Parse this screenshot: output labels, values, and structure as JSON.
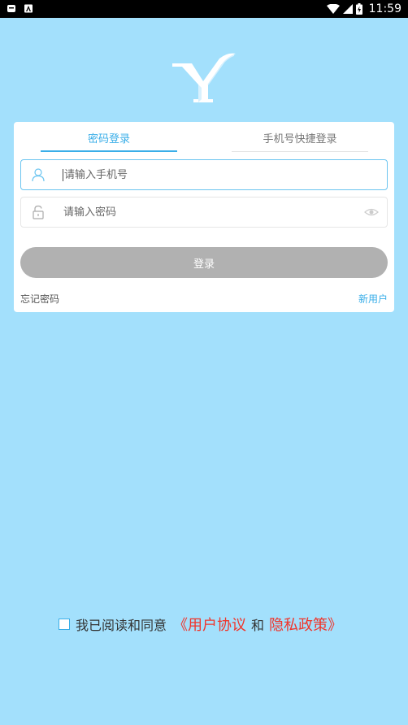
{
  "status_bar": {
    "time": "11:59"
  },
  "tabs": {
    "password_login": "密码登录",
    "phone_login": "手机号快捷登录"
  },
  "form": {
    "phone_placeholder": "请输入手机号",
    "password_placeholder": "请输入密码",
    "login_label": "登录",
    "forgot_password": "忘记密码",
    "new_user": "新用户"
  },
  "agreement": {
    "prefix": "我已阅读和同意",
    "user_agreement": "《用户协议",
    "conjunction": "和",
    "privacy_policy": "隐私政策》"
  },
  "colors": {
    "background": "#a3e0fc",
    "accent": "#3aaee8",
    "link_red": "#f0352b",
    "button_disabled": "#b1b1b1"
  }
}
